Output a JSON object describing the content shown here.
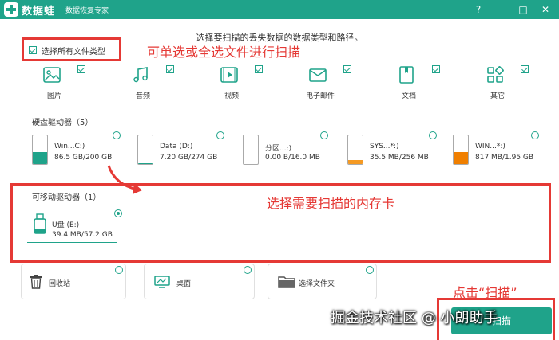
{
  "titlebar": {
    "app_name": "数据蛙",
    "subtitle": "数据恢复专家",
    "buttons": [
      "?",
      "—",
      "□",
      "✕"
    ]
  },
  "main": {
    "instruction": "选择要扫描的丢失数据的数据类型和路径。",
    "select_all_label": "选择所有文件类型",
    "select_all_checked": true
  },
  "annotations": {
    "select_note": "可单选或全选文件进行扫描",
    "card_note": "选择需要扫描的内存卡",
    "scan_note": "点击“扫描”"
  },
  "file_types": [
    {
      "label": "图片",
      "icon": "image-icon",
      "checked": true
    },
    {
      "label": "音频",
      "icon": "music-icon",
      "checked": true
    },
    {
      "label": "视频",
      "icon": "video-icon",
      "checked": true
    },
    {
      "label": "电子邮件",
      "icon": "mail-icon",
      "checked": true
    },
    {
      "label": "文档",
      "icon": "document-icon",
      "checked": true
    },
    {
      "label": "其它",
      "icon": "other-icon",
      "checked": true
    }
  ],
  "hard_drives": {
    "title": "硬盘驱动器（5）",
    "items": [
      {
        "name": "Win...C:)",
        "size": "86.5 GB/200 GB",
        "fill": 0.43,
        "color": "#1fa38a"
      },
      {
        "name": "Data (D:)",
        "size": "7.20 GB/274 GB",
        "fill": 0.03,
        "color": "#1fa38a"
      },
      {
        "name": "分区...:)",
        "size": "0.00  B/16.0 MB",
        "fill": 0.0,
        "color": "#1fa38a"
      },
      {
        "name": "SYS...*:)",
        "size": "35.5 MB/256 MB",
        "fill": 0.14,
        "color": "#f59a23"
      },
      {
        "name": "WIN...*:)",
        "size": "817 MB/1.95 GB",
        "fill": 0.42,
        "color": "#f07f00"
      }
    ]
  },
  "removable": {
    "title": "可移动驱动器（1）",
    "items": [
      {
        "name": "U盘 (E:)",
        "size": "39.4 MB/57.2 GB",
        "selected": true
      }
    ]
  },
  "locations": [
    {
      "label": "回收站",
      "icon": "trash-icon"
    },
    {
      "label": "桌面",
      "icon": "desktop-icon"
    },
    {
      "label": "选择文件夹",
      "icon": "folder-icon"
    }
  ],
  "scan_button": "扫描",
  "watermark": "掘金技术社区 @ 小朗助手",
  "colors": {
    "accent": "#1fa38a",
    "annotation": "#e53935",
    "orange": "#f07f00"
  }
}
